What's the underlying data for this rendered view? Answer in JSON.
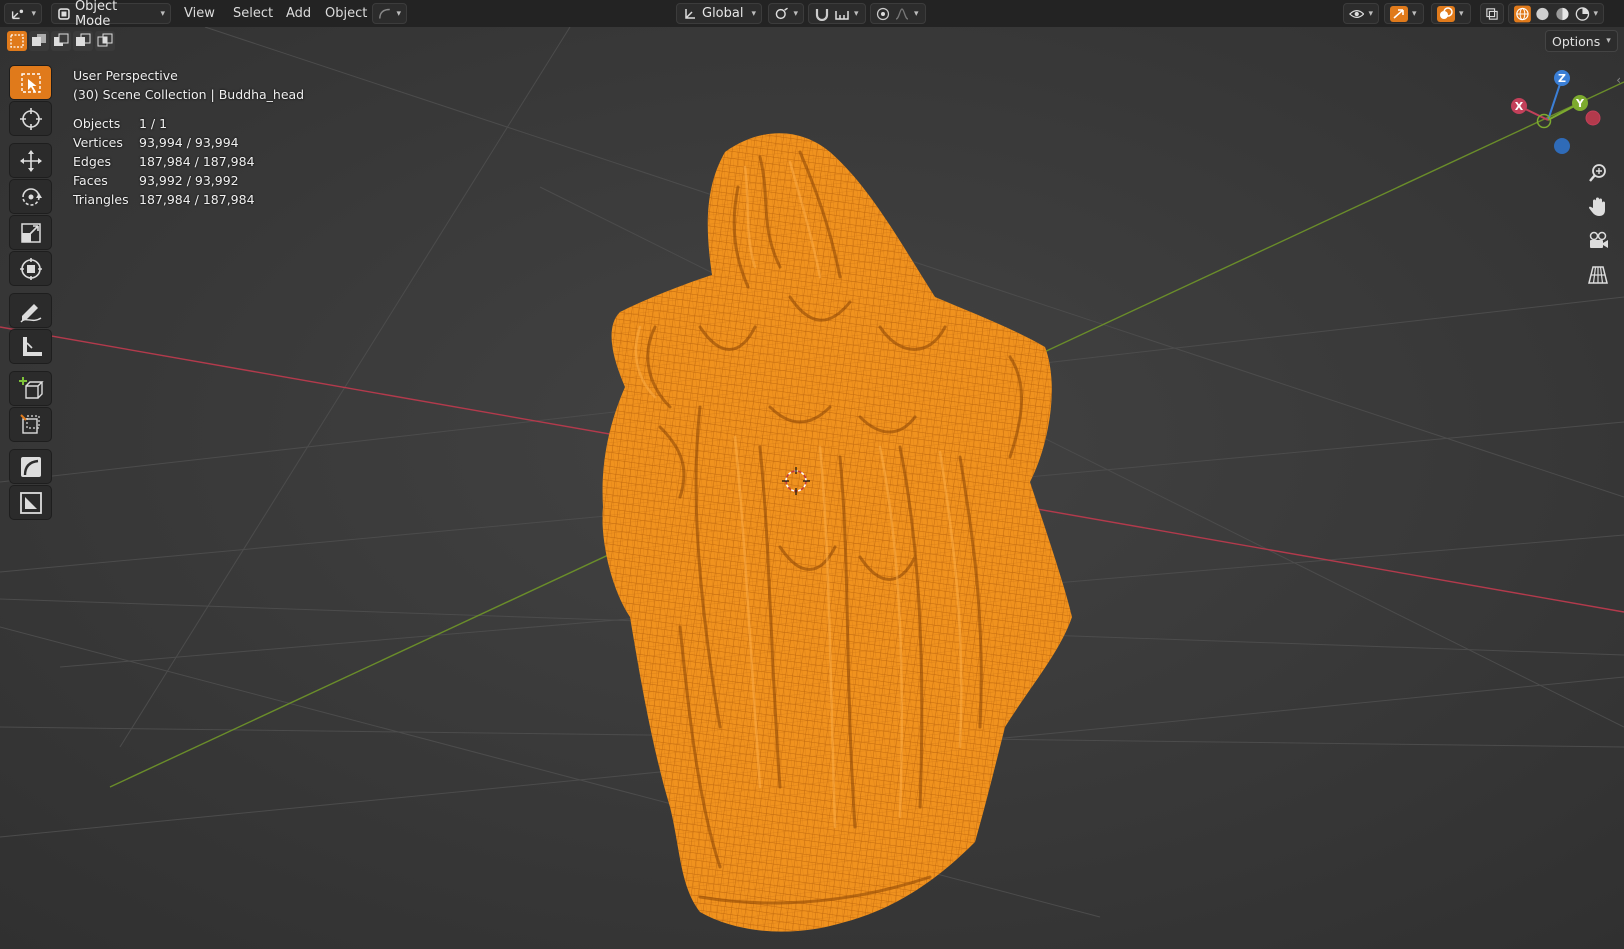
{
  "header": {
    "mode_label": "Object Mode",
    "menus": [
      "View",
      "Select",
      "Add",
      "Object"
    ],
    "transform_orientation": "Global"
  },
  "options_label": "Options",
  "overlay": {
    "perspective": "User Perspective",
    "collection_line": "(30) Scene Collection | Buddha_head",
    "stats": [
      {
        "label": "Objects",
        "value": "1 / 1"
      },
      {
        "label": "Vertices",
        "value": "93,994 / 93,994"
      },
      {
        "label": "Edges",
        "value": "187,984 / 187,984"
      },
      {
        "label": "Faces",
        "value": "93,992 / 93,992"
      },
      {
        "label": "Triangles",
        "value": "187,984 / 187,984"
      }
    ]
  },
  "gizmo": {
    "x": "X",
    "y": "Y",
    "z": "Z"
  },
  "tools": [
    "select-box-icon",
    "cursor-icon",
    "move-icon",
    "rotate-icon",
    "scale-icon",
    "transform-icon",
    "annotate-icon",
    "measure-icon",
    "add-cube-icon",
    "clip-icon",
    "shear-icon",
    "frame-icon"
  ],
  "colors": {
    "accent": "#e07a1b",
    "mesh": "#f0921e",
    "x_axis": "#c3405a",
    "y_axis": "#7dab2f",
    "z_axis": "#3b7fd6",
    "background": "#3a3a3a"
  }
}
